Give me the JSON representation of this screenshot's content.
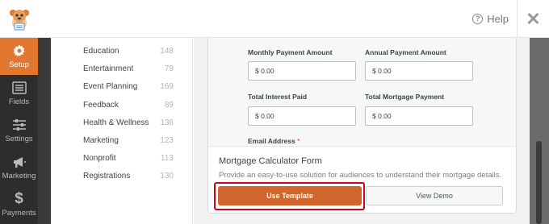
{
  "header": {
    "help_label": "Help"
  },
  "nav": [
    {
      "label": "Setup",
      "icon": "gear-icon"
    },
    {
      "label": "Fields",
      "icon": "fields-list-icon"
    },
    {
      "label": "Settings",
      "icon": "sliders-icon"
    },
    {
      "label": "Marketing",
      "icon": "megaphone-icon"
    },
    {
      "label": "Payments",
      "icon": "dollar-icon"
    }
  ],
  "categories": [
    {
      "name": "Education",
      "count": "148"
    },
    {
      "name": "Entertainment",
      "count": "79"
    },
    {
      "name": "Event Planning",
      "count": "169"
    },
    {
      "name": "Feedback",
      "count": "89"
    },
    {
      "name": "Health & Wellness",
      "count": "136"
    },
    {
      "name": "Marketing",
      "count": "123"
    },
    {
      "name": "Nonprofit",
      "count": "113"
    },
    {
      "name": "Registrations",
      "count": "130"
    }
  ],
  "preview": {
    "fields": [
      {
        "label": "Monthly Payment Amount",
        "value": "$ 0.00"
      },
      {
        "label": "Annual Payment Amount",
        "value": "$ 0.00"
      },
      {
        "label": "Total Interest Paid",
        "value": "$ 0.00"
      },
      {
        "label": "Total Mortgage Payment",
        "value": "$ 0.00"
      }
    ],
    "email_label": "Email Address",
    "required_mark": "*"
  },
  "template": {
    "title": "Mortgage Calculator Form",
    "description": "Provide an easy-to-use solution for audiences to understand their mortgage details.",
    "use_button": "Use Template",
    "demo_button": "View Demo"
  },
  "colors": {
    "accent": "#e27730",
    "use_button": "#d0662e",
    "highlight": "#d0021b",
    "nav_bg": "#2d2d2d"
  }
}
